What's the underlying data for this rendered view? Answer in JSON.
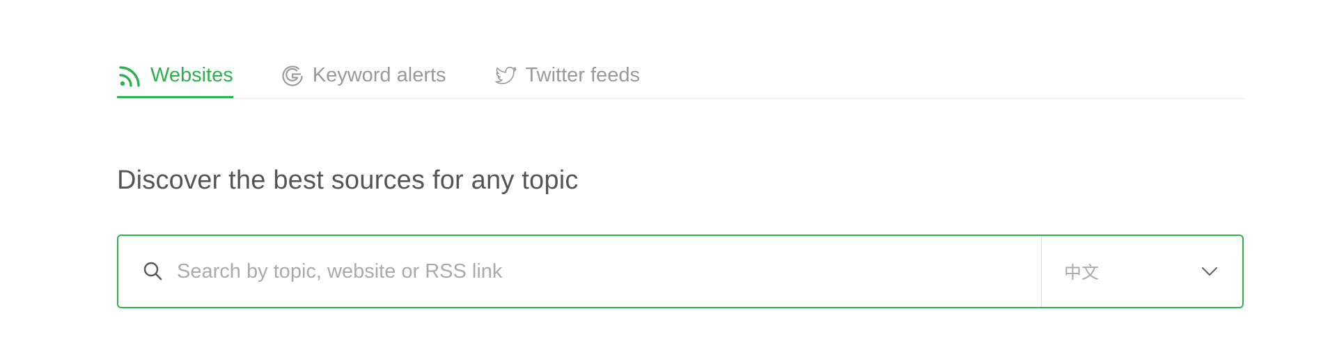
{
  "tabs": [
    {
      "label": "Websites",
      "icon": "rss-icon",
      "active": true
    },
    {
      "label": "Keyword alerts",
      "icon": "google-icon",
      "active": false
    },
    {
      "label": "Twitter feeds",
      "icon": "twitter-icon",
      "active": false
    }
  ],
  "headline": "Discover the best sources for any topic",
  "search": {
    "placeholder": "Search by topic, website or RSS link",
    "value": "",
    "icon": "search-icon"
  },
  "language": {
    "selected": "中文",
    "icon": "chevron-down-icon"
  },
  "colors": {
    "accent": "#2bb24c",
    "muted": "#999999",
    "text": "#555555",
    "border": "#dcdcdc"
  }
}
